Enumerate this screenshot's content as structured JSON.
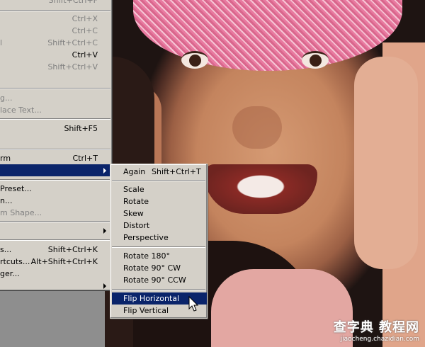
{
  "menu_main": {
    "items": [
      {
        "label": "",
        "shortcut": "Shift+Ctrl+F",
        "disabled": true
      },
      {
        "label": "",
        "shortcut": "Ctrl+X",
        "disabled": true
      },
      {
        "label": "",
        "shortcut": "Ctrl+C",
        "disabled": true
      },
      {
        "label": "l",
        "shortcut": "Shift+Ctrl+C",
        "disabled": true
      },
      {
        "label": "",
        "shortcut": "Ctrl+V",
        "disabled": false
      },
      {
        "label": "",
        "shortcut": "Shift+Ctrl+V",
        "disabled": true
      },
      {
        "label": "g...",
        "shortcut": "",
        "disabled": true
      },
      {
        "label": "lace Text...",
        "shortcut": "",
        "disabled": true
      },
      {
        "label": "",
        "shortcut": "Shift+F5",
        "disabled": false
      },
      {
        "label": "rm",
        "shortcut": "Ctrl+T",
        "disabled": false
      },
      {
        "label": "",
        "shortcut": "",
        "disabled": false
      },
      {
        "label": "Preset...",
        "shortcut": "",
        "disabled": false
      },
      {
        "label": "n...",
        "shortcut": "",
        "disabled": false
      },
      {
        "label": "m Shape...",
        "shortcut": "",
        "disabled": true
      },
      {
        "label": "",
        "shortcut": "",
        "disabled": false
      },
      {
        "label": "s...",
        "shortcut": "Shift+Ctrl+K",
        "disabled": false
      },
      {
        "label": "rtcuts...",
        "shortcut": "Alt+Shift+Ctrl+K",
        "disabled": false
      },
      {
        "label": "ger...",
        "shortcut": "",
        "disabled": false
      }
    ]
  },
  "submenu": {
    "items": [
      {
        "label": "Again",
        "shortcut": "Shift+Ctrl+T"
      },
      {
        "label": "Scale"
      },
      {
        "label": "Rotate"
      },
      {
        "label": "Skew"
      },
      {
        "label": "Distort"
      },
      {
        "label": "Perspective"
      },
      {
        "label": "Rotate 180°"
      },
      {
        "label": "Rotate 90° CW"
      },
      {
        "label": "Rotate 90° CCW"
      },
      {
        "label": "Flip Horizontal"
      },
      {
        "label": "Flip Vertical"
      }
    ],
    "highlighted": "Flip Horizontal"
  },
  "watermark": {
    "main": "查字典 教程网",
    "url": "jiaocheng.chazidian.com"
  },
  "colors": {
    "menu_bg": "#d4d0c8",
    "highlight": "#0a246a",
    "disabled": "#808080"
  },
  "icons": [
    "submenu-arrow-icon",
    "mouse-pointer-icon"
  ]
}
